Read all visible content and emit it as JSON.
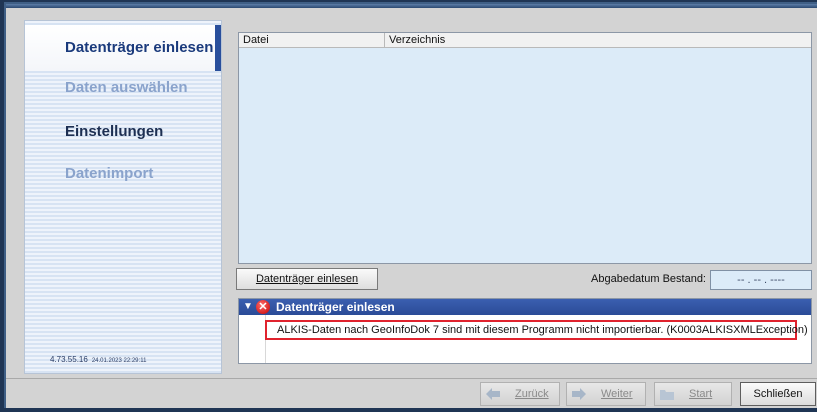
{
  "wizard": {
    "steps": [
      {
        "label": "Datenträger einlesen",
        "state": "active"
      },
      {
        "label": "Daten auswählen",
        "state": "inactive"
      },
      {
        "label": "Einstellungen",
        "state": "plain"
      },
      {
        "label": "Datenimport",
        "state": "inactive"
      }
    ],
    "version": "4.73.55.16",
    "build_date": "24.01.2023 22:29:11"
  },
  "filelist": {
    "columns": [
      "Datei",
      "Verzeichnis"
    ],
    "rows": []
  },
  "actions": {
    "read_button": "Datenträger einlesen",
    "abgabe_label": "Abgabedatum Bestand:",
    "abgabe_value": "-- . -- . ----"
  },
  "messages": {
    "group_title": "Datenträger einlesen",
    "error_text": "ALKIS-Daten nach GeoInfoDok 7 sind mit diesem Programm nicht importierbar. (K0003ALKISXMLException)"
  },
  "nav": {
    "back": "Zurück",
    "next": "Weiter",
    "start": "Start",
    "close": "Schließen"
  },
  "colors": {
    "accent": "#294f9c",
    "error": "#e0232e",
    "list_bg": "#dcebf8"
  }
}
